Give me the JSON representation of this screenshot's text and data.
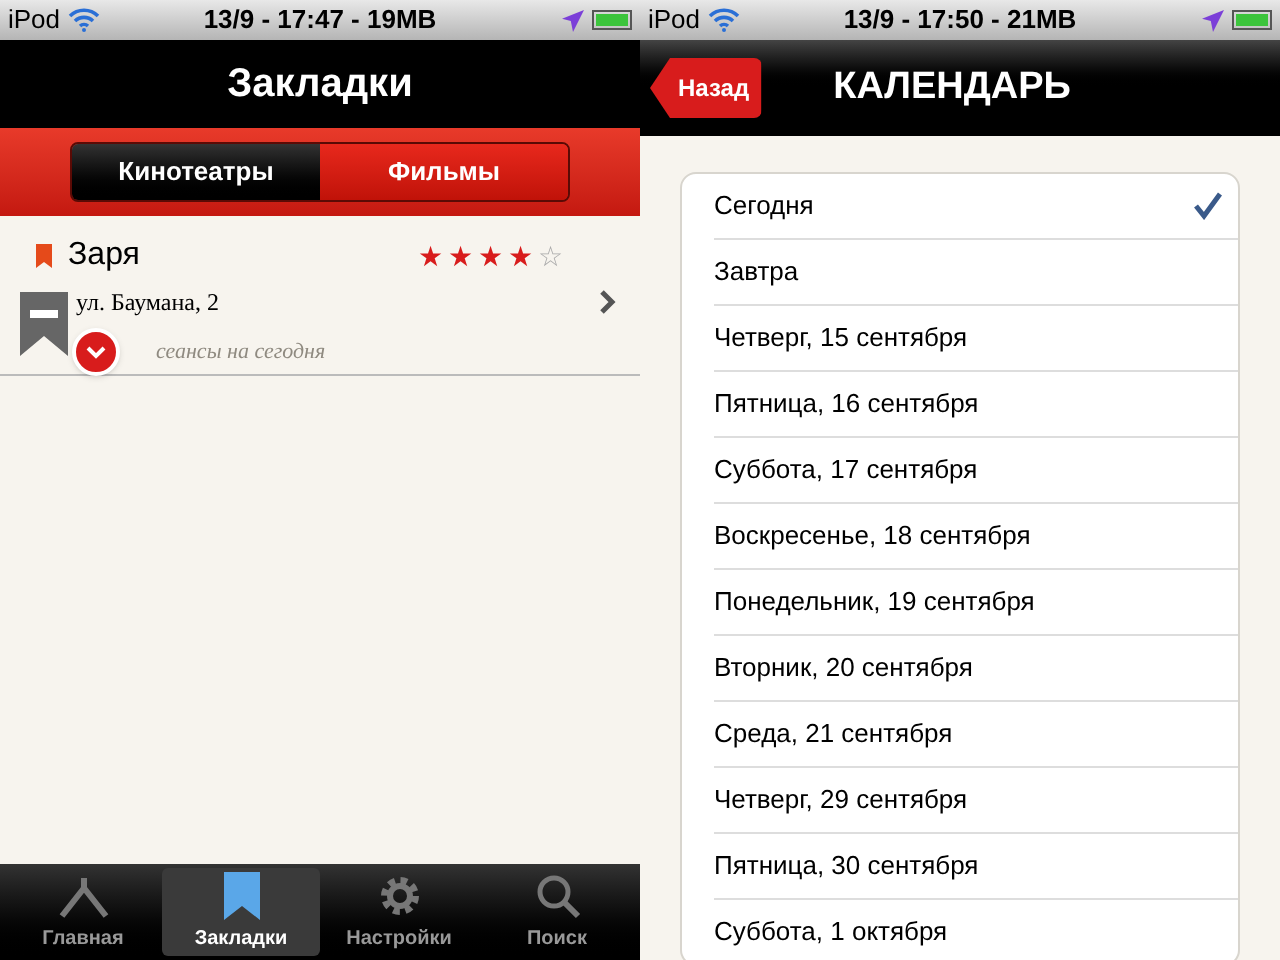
{
  "left": {
    "status_bar": {
      "carrier": "iPod",
      "time": "13/9 - 17:47 - 19MB"
    },
    "nav_title": "Закладки",
    "segments": [
      {
        "label": "Кинотеатры",
        "selected": true
      },
      {
        "label": "Фильмы",
        "selected": false
      }
    ],
    "items": [
      {
        "name": "Заря",
        "stars": 4,
        "address": "ул. Баумана, 2",
        "note": "сеансы на сегодня"
      }
    ],
    "tab_bar": [
      {
        "label": "Главная",
        "selected": false
      },
      {
        "label": "Закладки",
        "selected": true
      },
      {
        "label": "Настройки",
        "selected": false
      },
      {
        "label": "Поиск",
        "selected": false
      }
    ]
  },
  "right": {
    "status_bar": {
      "carrier": "iPod",
      "time": "13/9 - 17:50 - 21MB"
    },
    "back_button": "Назад",
    "nav_title": "КАЛЕНДАРЬ",
    "dates": [
      {
        "label": "Сегодня",
        "selected": true
      },
      {
        "label": "Завтра",
        "selected": false
      },
      {
        "label": "Четверг, 15 сентября",
        "selected": false
      },
      {
        "label": "Пятница, 16 сентября",
        "selected": false
      },
      {
        "label": "Суббота, 17 сентября",
        "selected": false
      },
      {
        "label": "Воскресенье, 18 сентября",
        "selected": false
      },
      {
        "label": "Понедельник, 19 сентября",
        "selected": false
      },
      {
        "label": "Вторник, 20 сентября",
        "selected": false
      },
      {
        "label": "Среда, 21 сентября",
        "selected": false
      },
      {
        "label": "Четверг, 29 сентября",
        "selected": false
      },
      {
        "label": "Пятница, 30 сентября",
        "selected": false
      },
      {
        "label": "Суббота, 1 октября",
        "selected": false
      }
    ]
  }
}
